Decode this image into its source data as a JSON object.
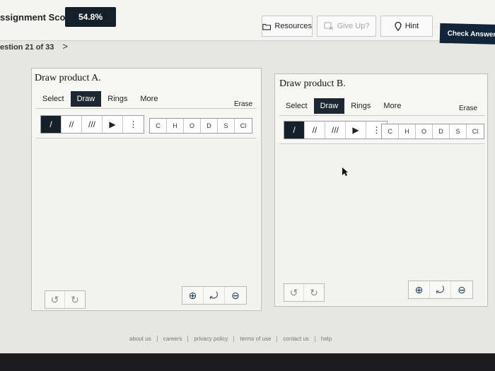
{
  "header": {
    "score_label": "ssignment Score:",
    "score_value": "54.8%",
    "resources_label": "Resources",
    "giveup_label": "Give Up?",
    "hint_label": "Hint",
    "check_label": "Check Answer"
  },
  "question_nav": {
    "text": "estion 21 of 33",
    "next": ">"
  },
  "panels": [
    {
      "title": "Draw product A.",
      "tabs": [
        "Select",
        "Draw",
        "Rings",
        "More"
      ],
      "active_tab": "Draw",
      "erase": "Erase",
      "bonds": [
        "/",
        "//",
        "///",
        "▶",
        "⋮"
      ],
      "atoms": [
        "C",
        "H",
        "O",
        "D",
        "S",
        "Cl"
      ]
    },
    {
      "title": "Draw product B.",
      "tabs": [
        "Select",
        "Draw",
        "Rings",
        "More"
      ],
      "active_tab": "Draw",
      "erase": "Erase",
      "bonds": [
        "/",
        "//",
        "///",
        "▶",
        "⋮"
      ],
      "atoms": [
        "C",
        "H",
        "O",
        "D",
        "S",
        "Cl"
      ]
    }
  ],
  "icons": {
    "undo": "↺",
    "redo": "↻",
    "zoom_in": "⊕",
    "zoom_reset": "⤾",
    "zoom_out": "⊖"
  },
  "footer": [
    "about us",
    "careers",
    "privacy policy",
    "terms of use",
    "contact us",
    "help"
  ]
}
